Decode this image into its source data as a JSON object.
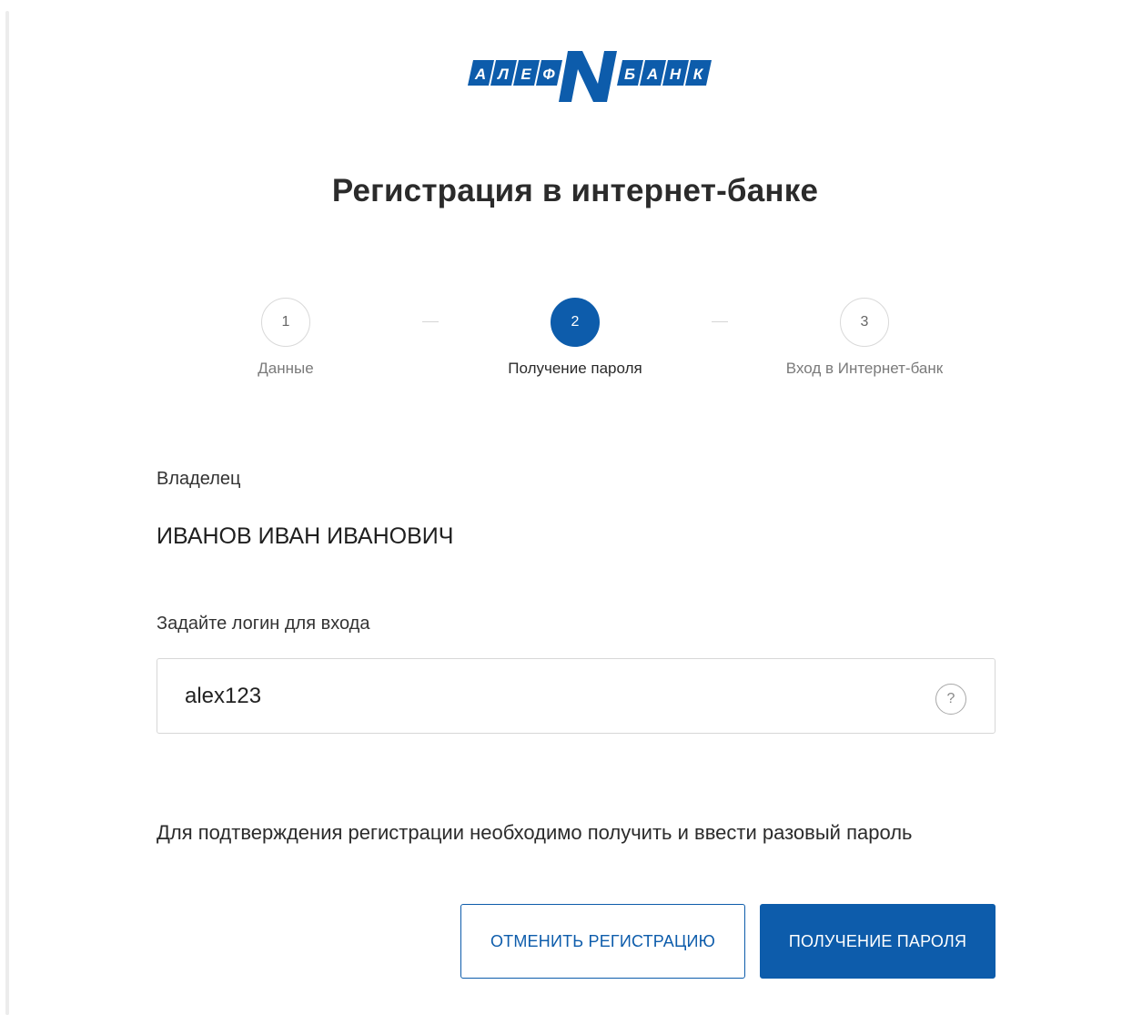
{
  "logo": {
    "letters_left": [
      "А",
      "Л",
      "Е",
      "Ф"
    ],
    "letter_center": "N",
    "letters_right": [
      "Б",
      "А",
      "Н",
      "К"
    ],
    "color": "#0d5cab"
  },
  "page_title": "Регистрация в интернет-банке",
  "steps": [
    {
      "number": "1",
      "label": "Данные",
      "active": false
    },
    {
      "number": "2",
      "label": "Получение пароля",
      "active": true
    },
    {
      "number": "3",
      "label": "Вход в Интернет-банк",
      "active": false
    }
  ],
  "owner": {
    "label": "Владелец",
    "name": "ИВАНОВ ИВАН ИВАНОВИЧ"
  },
  "login": {
    "label": "Задайте логин для входа",
    "value": "alex123",
    "help_icon": "question-circle-icon",
    "help_glyph": "?"
  },
  "confirm_text": "Для подтверждения регистрации необходимо получить и ввести разовый пароль",
  "buttons": {
    "cancel": "ОТМЕНИТЬ РЕГИСТРАЦИЮ",
    "get_password": "ПОЛУЧЕНИЕ ПАРОЛЯ"
  },
  "colors": {
    "accent": "#0d5cab",
    "text": "#2b2b2b",
    "muted": "#7a7a7a",
    "border": "#d7d7d7"
  }
}
